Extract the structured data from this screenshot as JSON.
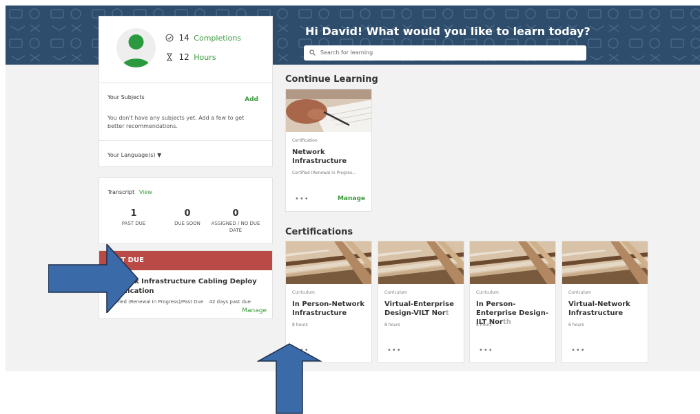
{
  "header": {
    "greeting": "Hi David! What would you like to learn today?",
    "search_placeholder": "Search for learning"
  },
  "profile": {
    "completions_count": "14",
    "completions_label": "Completions",
    "hours_count": "12",
    "hours_label": "Hours",
    "subjects_title": "Your Subjects",
    "add_label": "Add",
    "subjects_message": "You don't have any subjects yet. Add a few to get better recommendations.",
    "language_label": "Your Language(s)"
  },
  "transcript": {
    "title": "Transcript",
    "view_label": "View",
    "stats": [
      {
        "value": "1",
        "label": "PAST DUE"
      },
      {
        "value": "0",
        "label": "DUE SOON"
      },
      {
        "value": "0",
        "label": "ASSIGNED / NO DUE DATE"
      }
    ]
  },
  "past_due": {
    "header": "PAST DUE",
    "course_title": "Network Infrastructure Cabling Deploy Certification",
    "status": "Certified (Renewal In Progress)/Past Due",
    "days_past_due": "42 days past due",
    "manage_label": "Manage"
  },
  "continue_learning": {
    "title": "Continue Learning",
    "item": {
      "type": "Certification",
      "name": "Network Infrastructure",
      "status": "Certified (Renewal In Progres...",
      "more": "•••",
      "manage_label": "Manage"
    }
  },
  "certifications": {
    "title": "Certifications",
    "items": [
      {
        "type": "Curriculum",
        "name_main": "In Person-Network Infrastructure",
        "name_fade": "",
        "hours": "8 hours",
        "more": "•••"
      },
      {
        "type": "Curriculum",
        "name_main": "Virtual-Enterprise Design-VILT Nor",
        "name_fade": "t",
        "hours": "8 hours",
        "more": "•••"
      },
      {
        "type": "Curriculum",
        "name_main": "In Person-Enterprise Design-ILT Nor",
        "name_fade": "th",
        "hours": "8 hours",
        "more": "•••"
      },
      {
        "type": "Curriculum",
        "name_main": "Virtual-Network Infrastructure",
        "name_fade": "",
        "hours": "6 hours",
        "more": "•••"
      }
    ]
  },
  "colors": {
    "hero_bg": "#2e4d6d",
    "accent_green": "#3a9a3a",
    "past_due_red": "#b94a45",
    "annotation_arrow": "#3b6aa8"
  }
}
